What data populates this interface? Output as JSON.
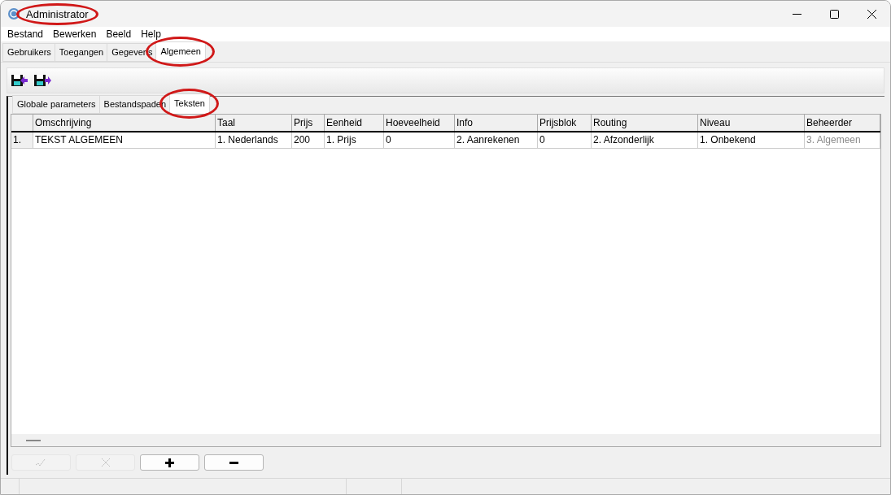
{
  "window": {
    "title": "Administrator",
    "circled": true
  },
  "menu": [
    "Bestand",
    "Bewerken",
    "Beeld",
    "Help"
  ],
  "tabs": [
    {
      "label": "Gebruikers",
      "selected": false,
      "circled": false
    },
    {
      "label": "Toegangen",
      "selected": false,
      "circled": false
    },
    {
      "label": "Gegevens",
      "selected": false,
      "circled": false
    },
    {
      "label": "Algemeen",
      "selected": true,
      "circled": true
    }
  ],
  "toolbar": [
    {
      "kind": "import"
    },
    {
      "kind": "export"
    }
  ],
  "subtabs": [
    {
      "label": "Globale parameters",
      "selected": false,
      "circled": false
    },
    {
      "label": "Bestandspaden",
      "selected": false,
      "circled": false
    },
    {
      "label": "Teksten",
      "selected": true,
      "circled": true
    }
  ],
  "table": {
    "columns": [
      "Omschrijving",
      "Taal",
      "Prijs",
      "Eenheid",
      "Hoeveelheid",
      "Info",
      "Prijsblok",
      "Routing",
      "Niveau",
      "Beheerder"
    ],
    "rows": [
      {
        "index": "1.",
        "cells": [
          {
            "text": "TEKST ALGEMEEN",
            "disabled": false
          },
          {
            "text": "1. Nederlands",
            "disabled": false
          },
          {
            "text": "200",
            "disabled": false
          },
          {
            "text": "1. Prijs",
            "disabled": false
          },
          {
            "text": "0",
            "disabled": false
          },
          {
            "text": "2. Aanrekenen",
            "disabled": false
          },
          {
            "text": "0",
            "disabled": false
          },
          {
            "text": "2. Afzonderlijk",
            "disabled": false
          },
          {
            "text": "1. Onbekend",
            "disabled": false
          },
          {
            "text": "3. Algemeen",
            "disabled": true
          }
        ]
      }
    ]
  },
  "buttons": [
    {
      "kind": "edit",
      "disabled": true
    },
    {
      "kind": "cancel",
      "disabled": true
    },
    {
      "kind": "add",
      "disabled": false
    },
    {
      "kind": "remove",
      "disabled": false
    }
  ]
}
